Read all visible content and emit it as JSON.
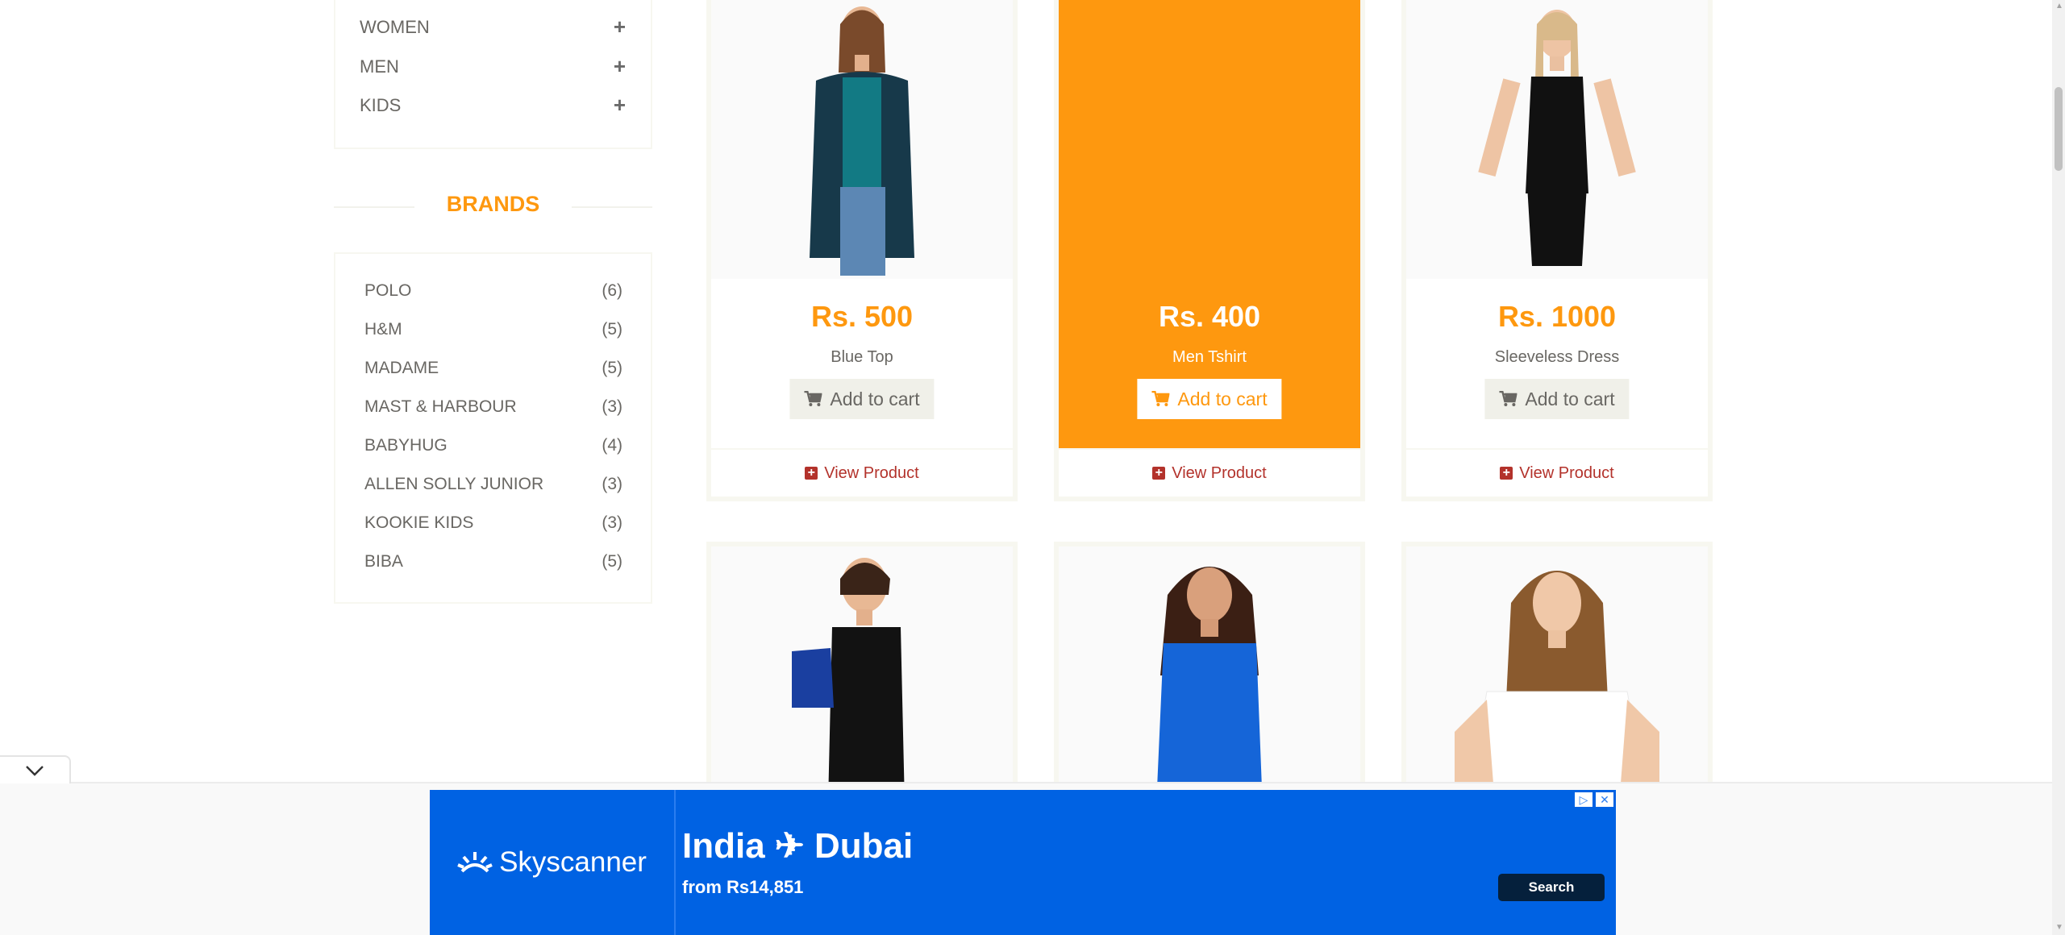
{
  "categories": [
    {
      "label": "WOMEN"
    },
    {
      "label": "MEN"
    },
    {
      "label": "KIDS"
    }
  ],
  "brands_title": "BRANDS",
  "brands": [
    {
      "name": "POLO",
      "count": "(6)"
    },
    {
      "name": "H&M",
      "count": "(5)"
    },
    {
      "name": "MADAME",
      "count": "(5)"
    },
    {
      "name": "MAST & HARBOUR",
      "count": "(3)"
    },
    {
      "name": "BABYHUG",
      "count": "(4)"
    },
    {
      "name": "ALLEN SOLLY JUNIOR",
      "count": "(3)"
    },
    {
      "name": "KOOKIE KIDS",
      "count": "(3)"
    },
    {
      "name": "BIBA",
      "count": "(5)"
    }
  ],
  "products": [
    {
      "price": "Rs. 500",
      "name": "Blue Top",
      "add_label": "Add to cart",
      "view_label": "View Product"
    },
    {
      "price": "Rs. 400",
      "name": "Men Tshirt",
      "add_label": "Add to cart",
      "view_label": "View Product"
    },
    {
      "price": "Rs. 1000",
      "name": "Sleeveless Dress",
      "add_label": "Add to cart",
      "view_label": "View Product"
    }
  ],
  "ad": {
    "brand": "Skyscanner",
    "title": "India ✈ Dubai",
    "subtitle": "from Rs14,851",
    "button": "Search"
  },
  "colors": {
    "accent": "#fe980f",
    "link": "#b3322b",
    "ad_blue": "#0062e3"
  }
}
